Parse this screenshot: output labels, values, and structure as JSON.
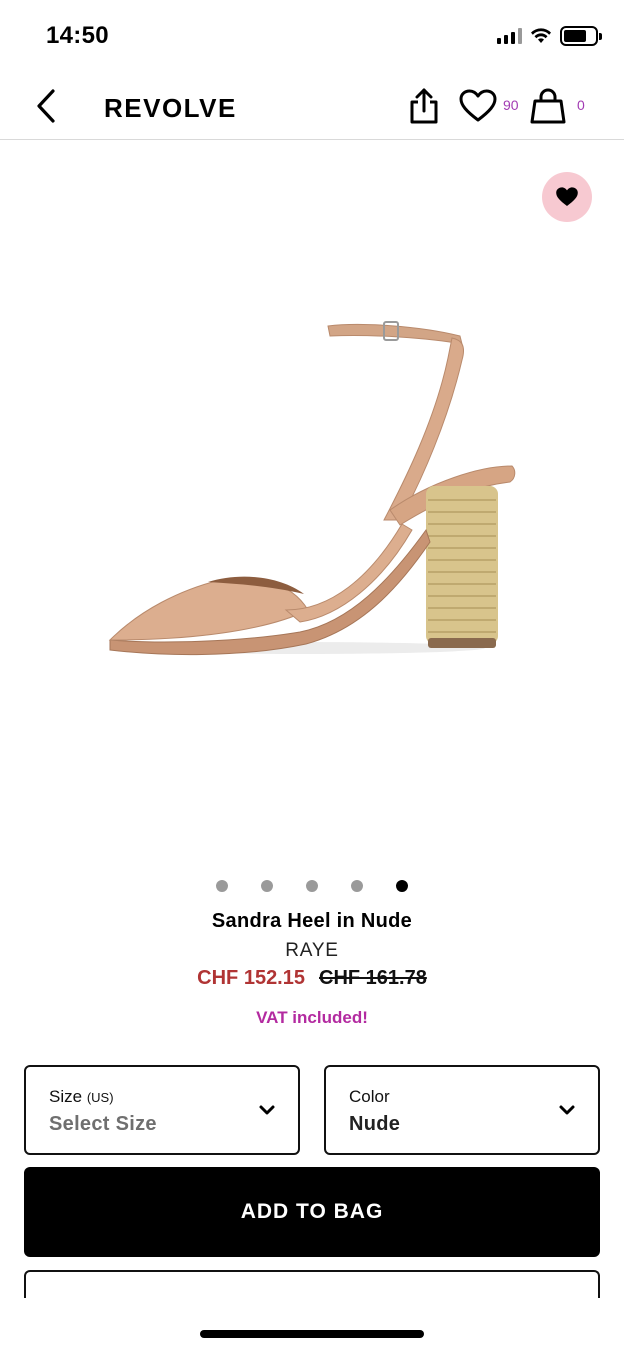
{
  "status_bar": {
    "time": "14:50"
  },
  "header": {
    "brand": "REVOLVE",
    "wishlist_count": "90",
    "bag_count": "0"
  },
  "colors": {
    "accent_purple": "#a23bb3",
    "sale_price": "#b03434",
    "vat_text": "#b32aa0",
    "fav_badge_bg": "#f7c9d1",
    "primary_button": "#000000"
  },
  "gallery": {
    "image_count": 5,
    "active_index": 4
  },
  "product": {
    "name": "Sandra Heel in Nude",
    "brand": "RAYE",
    "sale_price": "CHF 152.15",
    "original_price": "CHF 161.78",
    "vat_note": "VAT included!"
  },
  "size_select": {
    "label": "Size",
    "unit": "(US)",
    "value": "Select Size"
  },
  "color_select": {
    "label": "Color",
    "value": "Nude"
  },
  "actions": {
    "add_to_bag": "ADD TO BAG"
  }
}
